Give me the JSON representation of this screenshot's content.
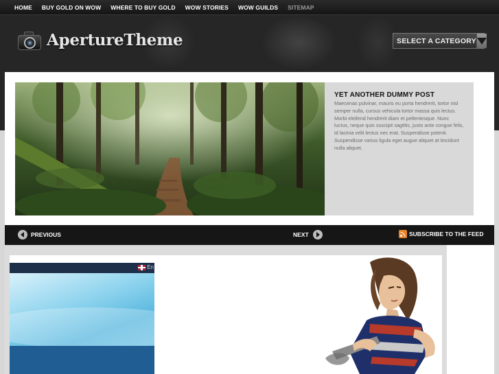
{
  "nav": {
    "items": [
      "HOME",
      "BUY GOLD ON WOW",
      "WHERE TO BUY GOLD",
      "WOW STORIES",
      "WOW GUILDS",
      "SITEMAP"
    ]
  },
  "logo": {
    "part1": "Aperture",
    "part2": "Theme"
  },
  "category_select": {
    "label": "SELECT A CATEGORY"
  },
  "featured": {
    "title": "YET ANOTHER DUMMY POST",
    "excerpt": "Maecenas pulvinar, mauris eu porta hendrerit, tortor nisl semper nulla, cursus vehicula tortor massa quis lectus. Morbi eleifend hendrerit diam et pellentesque. Nunc luctus, neque quis suscipit sagittis, justo ante congue felis, id lacinia velit lectus nec erat. Suspendisse potenti. Suspendisse varius ligula eget augue aliquet at tincidunt nulla aliquet."
  },
  "pager": {
    "previous": "PREVIOUS",
    "next": "NEXT",
    "subscribe": "SUBSCRIBE TO THE FEED"
  },
  "embed": {
    "language": "En"
  },
  "colors": {
    "nav_bg": "#1c1c1c",
    "header_bg": "#262626",
    "panel_bg": "#d9d9d9",
    "pager_bg": "#161616",
    "rss": "#e8842a"
  }
}
